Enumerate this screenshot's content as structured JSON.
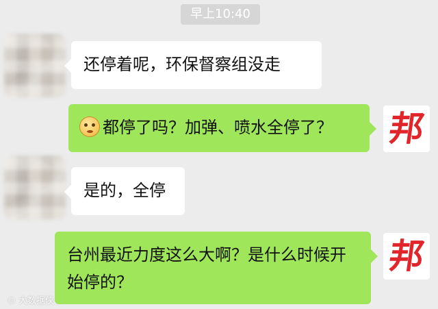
{
  "chat": {
    "timestamp": "早上10:40",
    "messages": [
      {
        "side": "left",
        "sender": "blurred",
        "text": "还停着呢，环保督察组没走"
      },
      {
        "side": "right",
        "sender": "bang",
        "emoji": "worried-face",
        "text": "都停了吗？加弹、喷水全停了？"
      },
      {
        "side": "left",
        "sender": "blurred",
        "text": "是的，全停"
      },
      {
        "side": "right",
        "sender": "bang",
        "text": "台州最近力度这么大啊？是什么时候开始停的？"
      }
    ],
    "bang_avatar_label": "邦",
    "watermark": "大数据侠"
  },
  "colors": {
    "background": "#ececec",
    "sent_bubble": "#9fe65a",
    "received_bubble": "#ffffff",
    "bang_red": "#e0262b"
  }
}
